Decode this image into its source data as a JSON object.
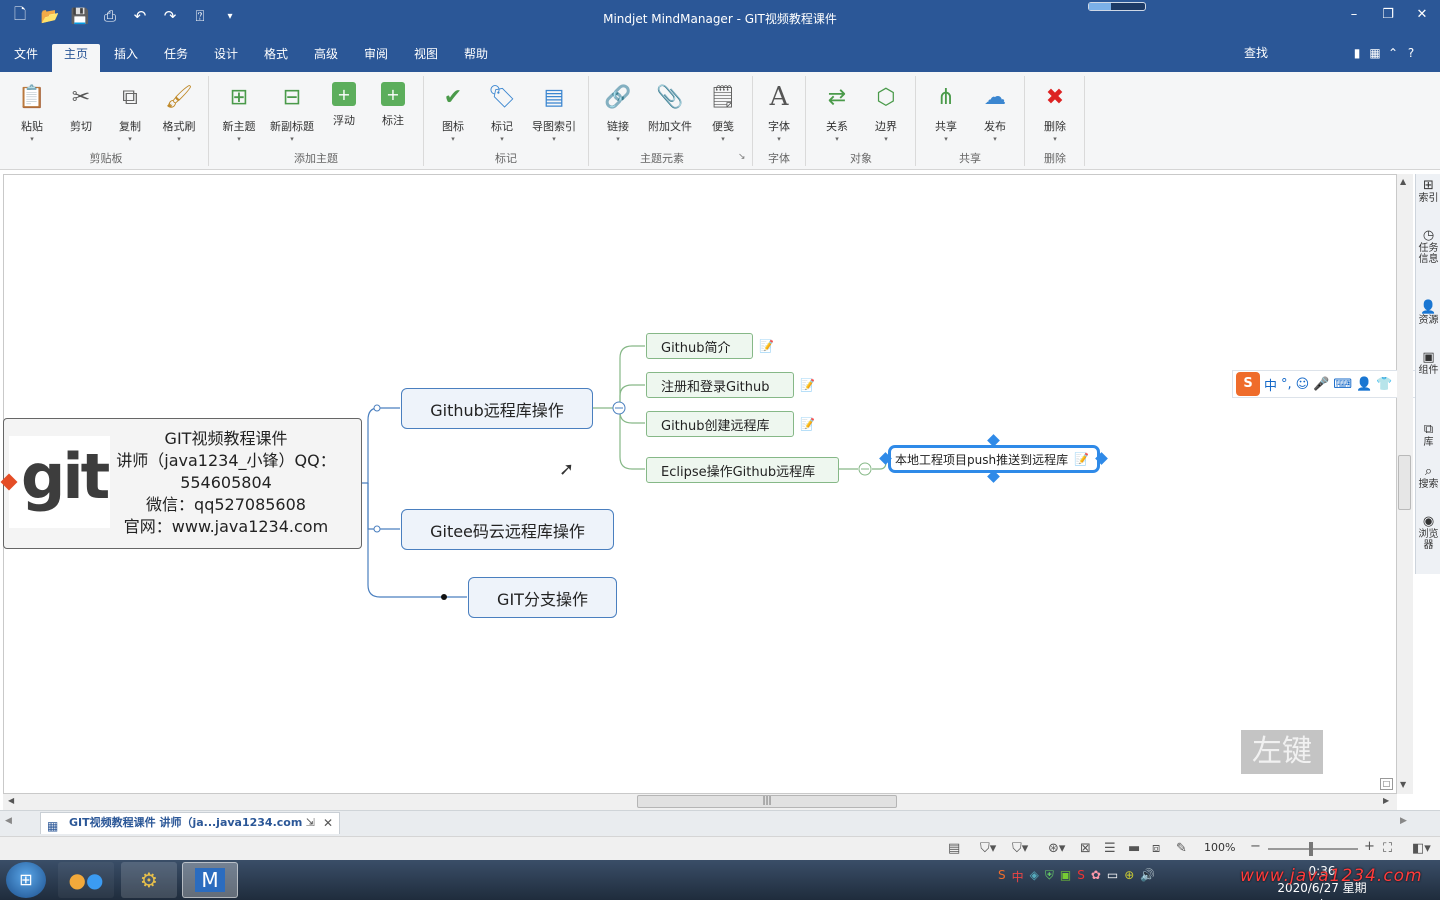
{
  "window": {
    "title": "Mindjet MindManager - GIT视频教程课件",
    "buttons": {
      "minimize": "–",
      "restore": "❐",
      "close": "✕"
    }
  },
  "tabs": [
    "文件",
    "主页",
    "插入",
    "任务",
    "设计",
    "格式",
    "高级",
    "审阅",
    "视图",
    "帮助"
  ],
  "active_tab": "主页",
  "search_label": "查找",
  "ribbon": {
    "buttons": [
      "粘贴",
      "剪切",
      "复制",
      "格式刷",
      "新主题",
      "新副标题",
      "浮动",
      "标注",
      "图标",
      "标记",
      "导图索引",
      "链接",
      "附加文件",
      "便笺",
      "字体",
      "关系",
      "边界",
      "共享",
      "发布",
      "删除"
    ],
    "groups": [
      "剪贴板",
      "添加主题",
      "标记",
      "主题元素",
      "字体",
      "对象",
      "共享",
      "删除"
    ]
  },
  "map": {
    "central_lines": [
      "GIT视频教程课件",
      "讲师（java1234_小锋）QQ：",
      "554605804",
      "微信：qq527085608",
      "官网：www.java1234.com"
    ],
    "logo_text": "git",
    "main_topics": [
      "Github远程库操作",
      "Gitee码云远程库操作",
      "GIT分支操作"
    ],
    "subtopics": [
      "Github简介",
      "注册和登录Github",
      "Github创建远程库",
      "Eclipse操作Github远程库"
    ],
    "selected_topic": "本地工程项目push推送到远程库"
  },
  "overlay": {
    "left_key": "左键"
  },
  "ime": {
    "lang": "中",
    "punct": "°,"
  },
  "side_panel": [
    "索引",
    "任务信息",
    "资源",
    "组件",
    "库",
    "搜索",
    "浏览器"
  ],
  "document_tab": "GIT视频教程课件 讲师（ja...java1234.com",
  "status": {
    "zoom": "100%"
  },
  "taskbar": {
    "time": "0:36",
    "date": "2020/6/27 星期六",
    "watermark": "www.java1234.com"
  }
}
